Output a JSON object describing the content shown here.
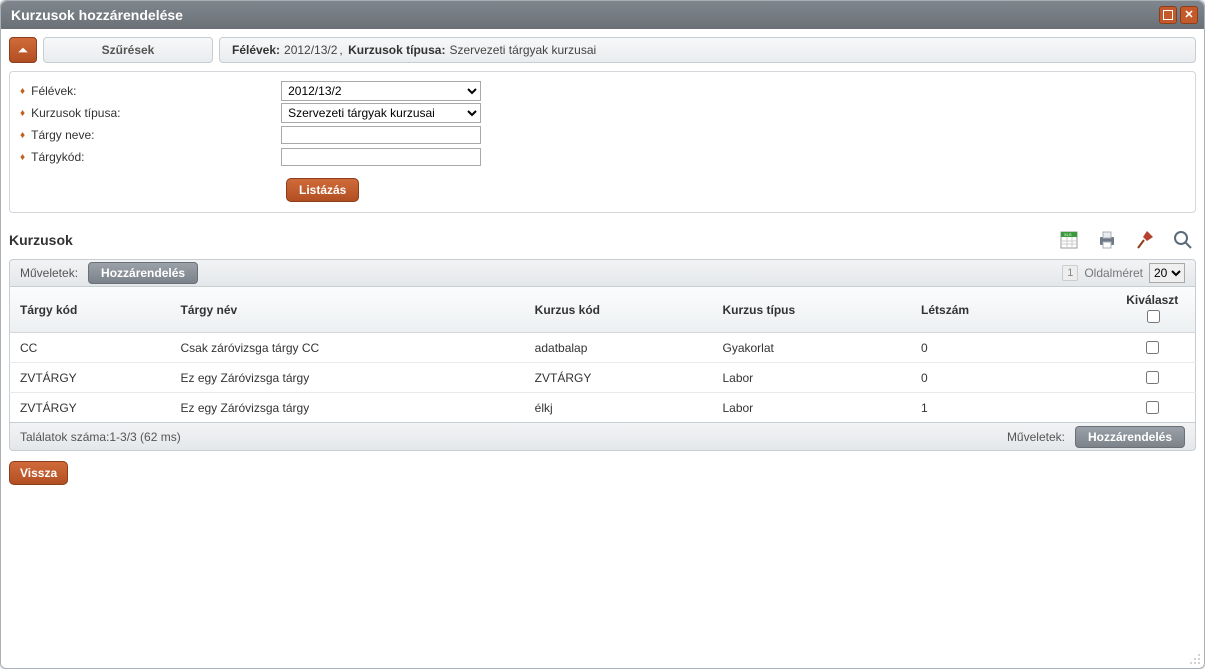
{
  "window": {
    "title": "Kurzusok hozzárendelése"
  },
  "filters": {
    "heading": "Szűrések",
    "summary": {
      "semester_label": "Félévek:",
      "semester_value": "2012/13/2",
      "course_type_label": "Kurzusok típusa:",
      "course_type_value": "Szervezeti tárgyak kurzusai"
    },
    "form": {
      "semester_label": "Félévek:",
      "semester_selected": "2012/13/2",
      "course_type_label": "Kurzusok típusa:",
      "course_type_selected": "Szervezeti tárgyak kurzusai",
      "subject_name_label": "Tárgy neve:",
      "subject_name_value": "",
      "subject_code_label": "Tárgykód:",
      "subject_code_value": "",
      "list_button": "Listázás"
    }
  },
  "section": {
    "title": "Kurzusok"
  },
  "ops": {
    "label": "Műveletek:",
    "assign_button": "Hozzárendelés",
    "page_number": "1",
    "page_size_label": "Oldalméret",
    "page_size_value": "20"
  },
  "table": {
    "headers": {
      "subject_code": "Tárgy kód",
      "subject_name": "Tárgy név",
      "course_code": "Kurzus kód",
      "course_type": "Kurzus típus",
      "headcount": "Létszám",
      "select": "Kiválaszt"
    },
    "rows": [
      {
        "subject_code": "CC",
        "subject_name": "Csak záróvizsga tárgy CC",
        "course_code": "adatbalap",
        "course_type": "Gyakorlat",
        "headcount": "0"
      },
      {
        "subject_code": "ZVTÁRGY",
        "subject_name": "Ez egy Záróvizsga tárgy",
        "course_code": "ZVTÁRGY",
        "course_type": "Labor",
        "headcount": "0"
      },
      {
        "subject_code": "ZVTÁRGY",
        "subject_name": "Ez egy Záróvizsga tárgy",
        "course_code": "élkj",
        "course_type": "Labor",
        "headcount": "1"
      }
    ],
    "footer": {
      "results": "Találatok száma:1-3/3 (62 ms)",
      "ops_label": "Műveletek:",
      "assign_button": "Hozzárendelés"
    }
  },
  "back_button": "Vissza"
}
